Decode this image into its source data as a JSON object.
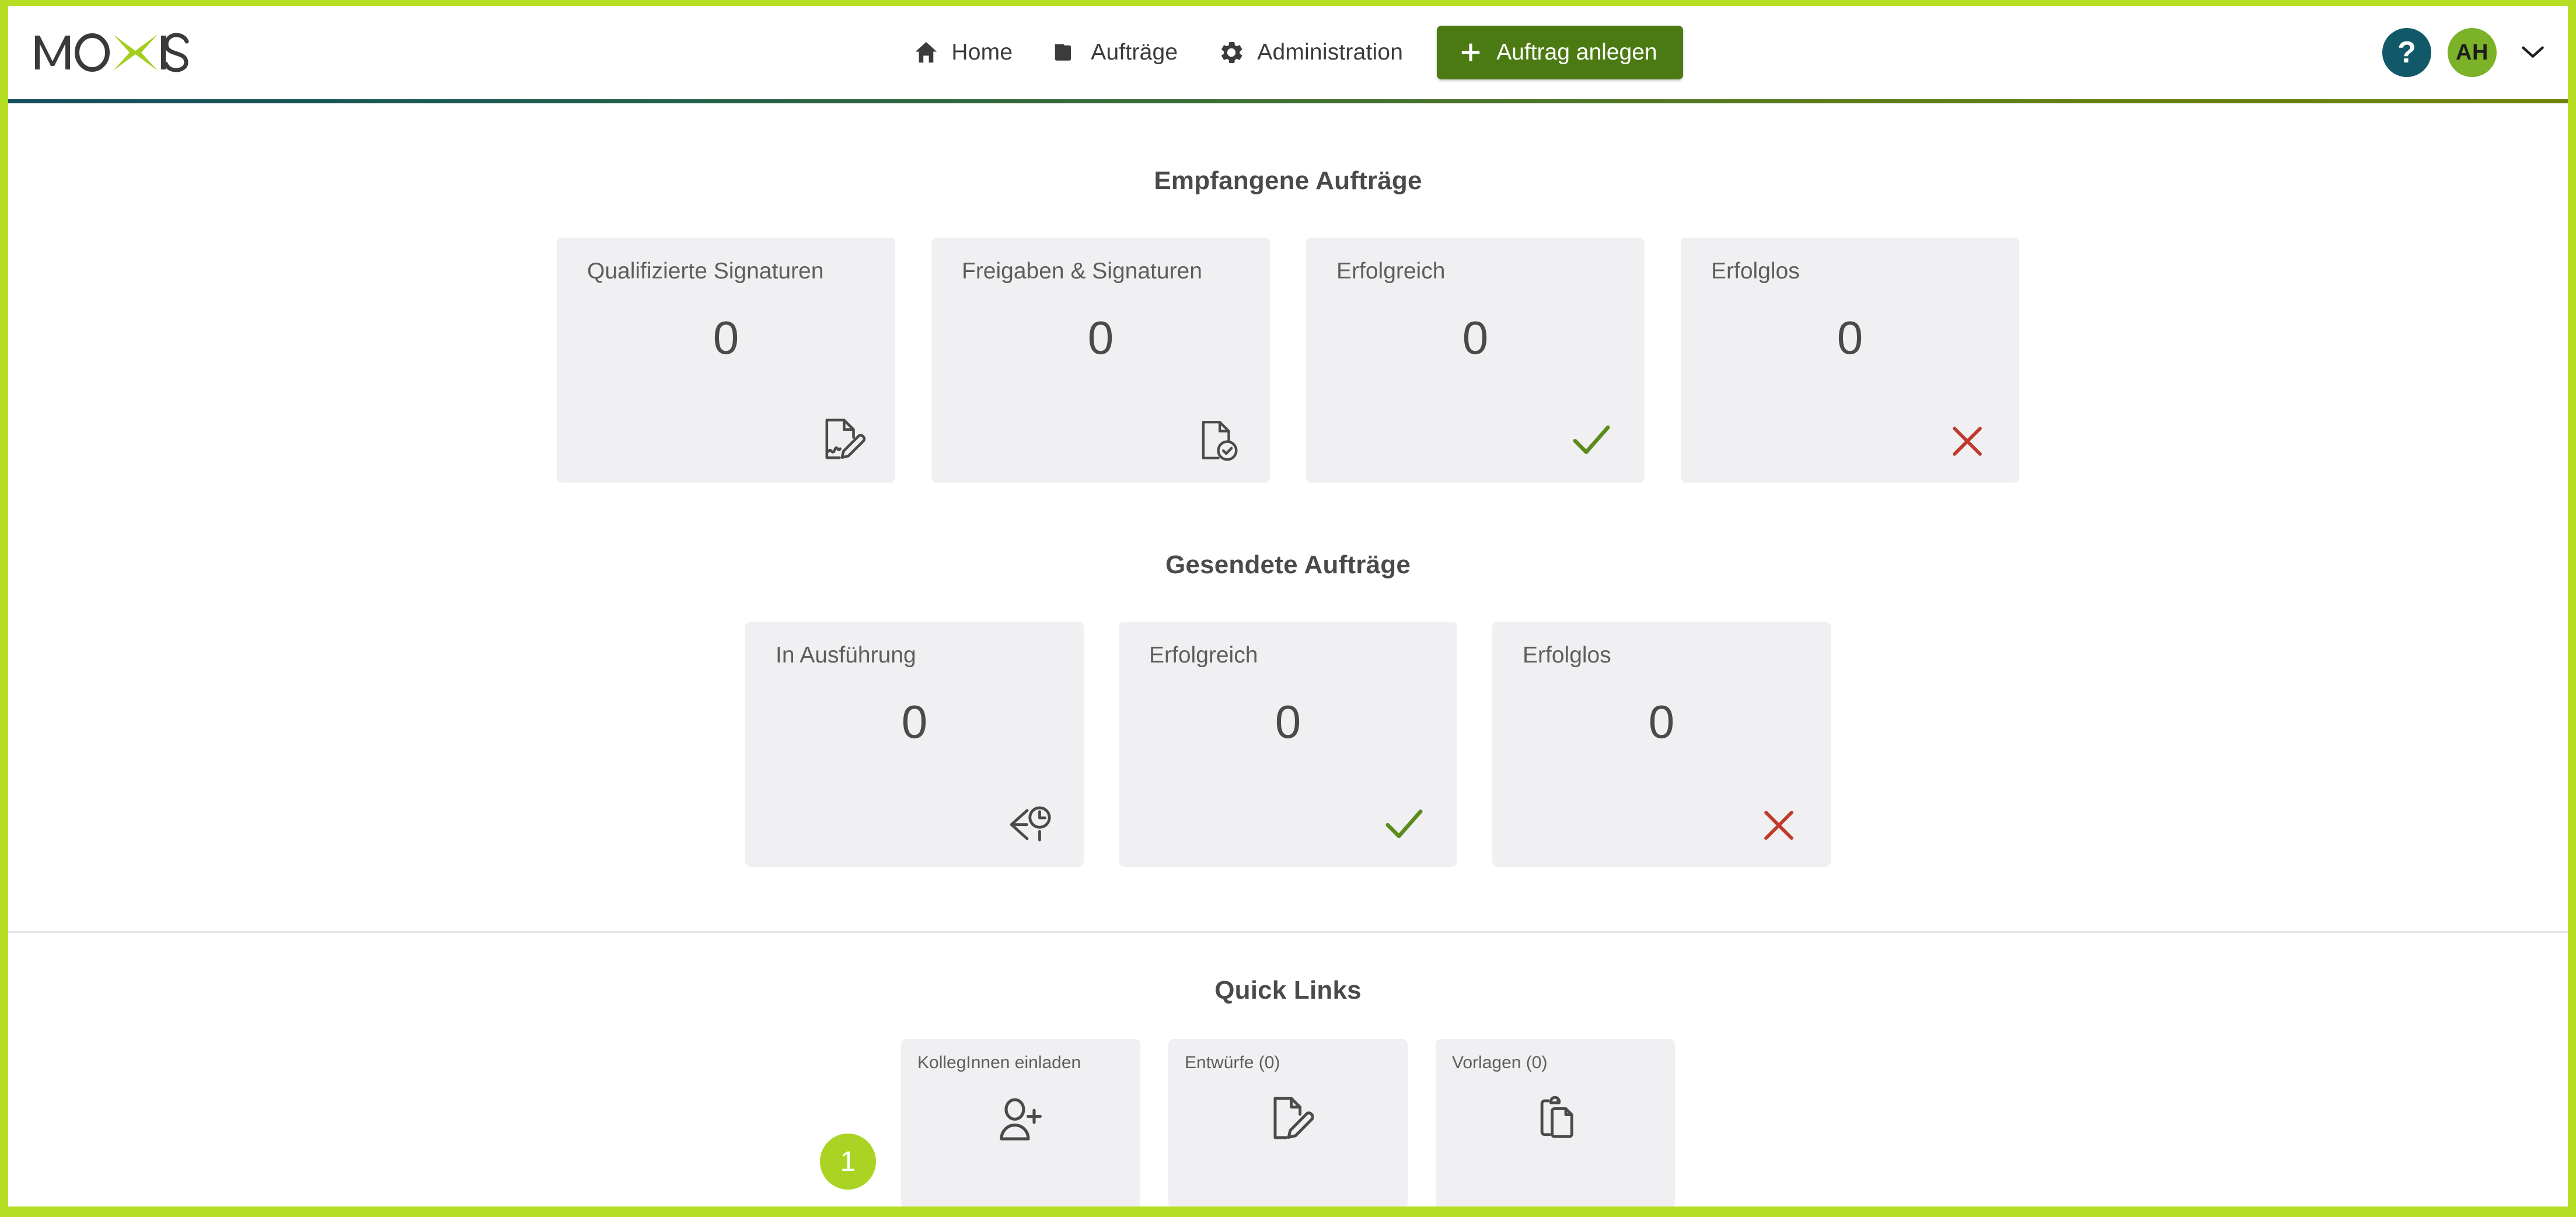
{
  "app": {
    "logo_text": "MOXIS",
    "brand_green": "#b5dd23",
    "accent_green": "#4c7a12",
    "badge_green": "#aad324",
    "help_teal": "#115968",
    "avatar_green": "#7cb228",
    "card_bg": "#f0f0f2",
    "success_color": "#5c8a1b",
    "error_color": "#c0392b"
  },
  "header": {
    "nav": [
      {
        "label": "Home",
        "icon": "home-icon"
      },
      {
        "label": "Aufträge",
        "icon": "folder-icon"
      },
      {
        "label": "Administration",
        "icon": "gear-icon"
      }
    ],
    "create_button": {
      "label": "Auftrag anlegen",
      "icon": "plus-icon"
    },
    "help_label": "?",
    "avatar_initials": "AH"
  },
  "received": {
    "title": "Empfangene Aufträge",
    "cards": [
      {
        "label": "Qualifizierte Signaturen",
        "count": "0",
        "icon": "document-sign-icon"
      },
      {
        "label": "Freigaben & Signaturen",
        "count": "0",
        "icon": "document-check-icon"
      },
      {
        "label": "Erfolgreich",
        "count": "0",
        "icon": "check-icon"
      },
      {
        "label": "Erfolglos",
        "count": "0",
        "icon": "cross-icon"
      }
    ]
  },
  "sent": {
    "title": "Gesendete Aufträge",
    "cards": [
      {
        "label": "In Ausführung",
        "count": "0",
        "icon": "arrow-clock-icon"
      },
      {
        "label": "Erfolgreich",
        "count": "0",
        "icon": "check-icon"
      },
      {
        "label": "Erfolglos",
        "count": "0",
        "icon": "cross-icon"
      }
    ]
  },
  "quick_links": {
    "title": "Quick Links",
    "step_badge": "1",
    "cards": [
      {
        "label": "KollegInnen einladen",
        "icon": "user-add-icon"
      },
      {
        "label": "Entwürfe (0)",
        "icon": "document-edit-icon"
      },
      {
        "label": "Vorlagen (0)",
        "icon": "template-copy-icon"
      }
    ]
  }
}
